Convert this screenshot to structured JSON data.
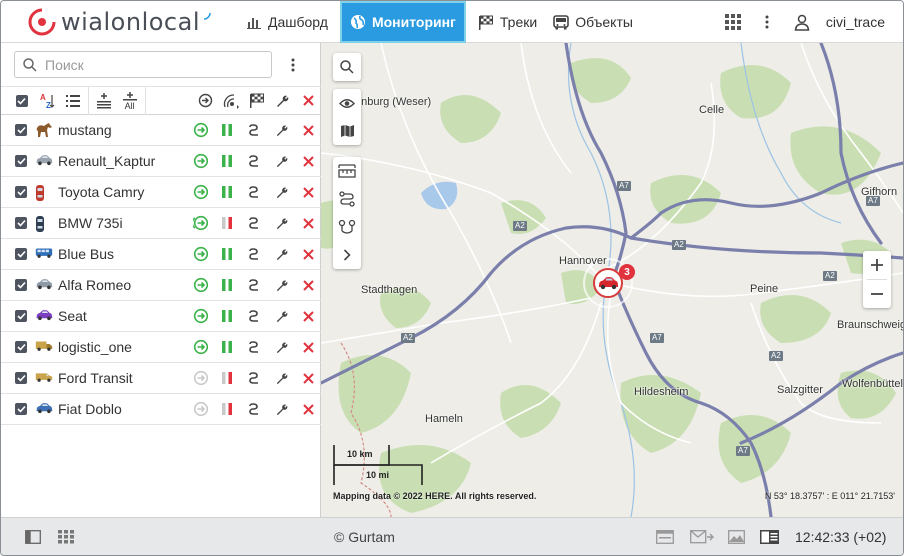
{
  "app": {
    "logo": {
      "part1": "wialon",
      "part2": "local"
    },
    "user": "civi_trace"
  },
  "nav": [
    {
      "id": "dashboard",
      "label": "Дашборд",
      "icon": "bar-chart-icon",
      "active": false
    },
    {
      "id": "monitoring",
      "label": "Мониторинг",
      "icon": "globe-icon",
      "active": true
    },
    {
      "id": "tracks",
      "label": "Треки",
      "icon": "checkered-flag-icon",
      "active": false
    },
    {
      "id": "objects",
      "label": "Объекты",
      "icon": "bus-icon",
      "active": false
    }
  ],
  "panel": {
    "search_placeholder": "Поиск",
    "toolbar": {
      "sort_label": "AZ",
      "add_all_label": "All"
    }
  },
  "units": [
    {
      "name": "mustang",
      "icon": "horse-icon",
      "color": "#8a5a2b",
      "online": true,
      "moving": false,
      "signal": "green"
    },
    {
      "name": "Renault_Kaptur",
      "icon": "car-icon",
      "color": "#9aa3ad",
      "online": true,
      "moving": false,
      "signal": "green"
    },
    {
      "name": "Toyota Camry",
      "icon": "car-top-icon",
      "color": "#c0392b",
      "online": true,
      "moving": false,
      "signal": "green"
    },
    {
      "name": "BMW 735i",
      "icon": "car-top-icon",
      "color": "#2c3e50",
      "online": true,
      "moving": true,
      "signal": "red"
    },
    {
      "name": "Blue Bus",
      "icon": "bus-icon",
      "color": "#2e6fb7",
      "online": true,
      "moving": false,
      "signal": "green"
    },
    {
      "name": "Alfa Romeo",
      "icon": "car-icon",
      "color": "#8f9aa6",
      "online": true,
      "moving": false,
      "signal": "green"
    },
    {
      "name": "Seat",
      "icon": "car-icon",
      "color": "#7b3fbf",
      "online": true,
      "moving": false,
      "signal": "green"
    },
    {
      "name": "logistic_one",
      "icon": "truck-icon",
      "color": "#c9a44a",
      "online": true,
      "moving": false,
      "signal": "green"
    },
    {
      "name": "Ford Transit",
      "icon": "van-icon",
      "color": "#c9a44a",
      "online": false,
      "moving": false,
      "signal": "red"
    },
    {
      "name": "Fiat Doblo",
      "icon": "car-icon",
      "color": "#3f6fb5",
      "online": false,
      "moving": false,
      "signal": "red"
    }
  ],
  "map": {
    "labels": [
      {
        "text": "enburg (Weser)"
      },
      {
        "text": "Celle"
      },
      {
        "text": "Gifhorn"
      },
      {
        "text": "Hannover"
      },
      {
        "text": "Stadthagen"
      },
      {
        "text": "Peine"
      },
      {
        "text": "Braunschweig"
      },
      {
        "text": "Hildesheim"
      },
      {
        "text": "Salzgitter"
      },
      {
        "text": "Wolfenbüttel"
      },
      {
        "text": "Hameln"
      }
    ],
    "road_badges": [
      "A7",
      "A2",
      "A2",
      "A7",
      "A2",
      "A2",
      "A7",
      "A7",
      "A2"
    ],
    "cluster_count": "3",
    "scale_km": "10 km",
    "scale_mi": "10 mi",
    "copyright": "Mapping data © 2022 HERE. All rights reserved.",
    "coords": "N 53° 18.3757' : E 011° 21.7153'"
  },
  "footer": {
    "copyright": "© Gurtam",
    "time": "12:42:33 (+02)"
  },
  "colors": {
    "accent": "#2a9ae1",
    "online": "#3bb34a",
    "offline": "#c9c9c9",
    "delete": "#e0333e"
  }
}
